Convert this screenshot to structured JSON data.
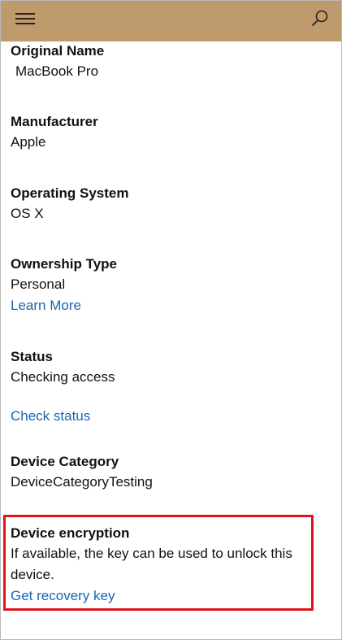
{
  "topbar": {
    "menu_icon": "hamburger-menu-icon",
    "search_icon": "search-icon",
    "background": "#bf9a6d"
  },
  "fields": {
    "original_name": {
      "label": "Original Name",
      "value": "MacBook Pro"
    },
    "manufacturer": {
      "label": "Manufacturer",
      "value": "Apple"
    },
    "operating_system": {
      "label": "Operating System",
      "value": "OS X"
    },
    "ownership_type": {
      "label": "Ownership Type",
      "value": "Personal",
      "link": "Learn More"
    },
    "status": {
      "label": "Status",
      "value": "Checking access",
      "link": "Check status"
    },
    "device_category": {
      "label": "Device Category",
      "value": "DeviceCategoryTesting"
    },
    "device_encryption": {
      "label": "Device encryption",
      "description": "If available, the key can be used to unlock this device.",
      "link": "Get recovery key"
    }
  },
  "colors": {
    "link": "#1a64b0",
    "highlight_border": "#e0121b"
  }
}
